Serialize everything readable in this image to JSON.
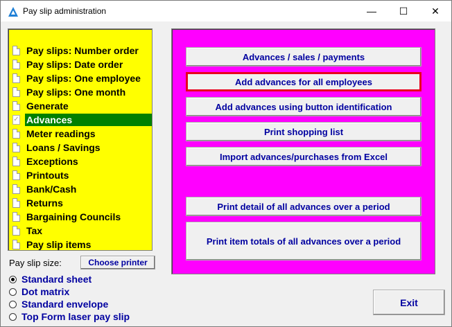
{
  "window": {
    "title": "Pay slip administration",
    "minimize_glyph": "—",
    "maximize_glyph": "☐",
    "close_glyph": "✕"
  },
  "menu": {
    "items": [
      {
        "label": "Pay slips: Number order",
        "icon": "document-icon"
      },
      {
        "label": "Pay slips: Date order",
        "icon": "document-icon"
      },
      {
        "label": "Pay slips: One employee",
        "icon": "document-icon"
      },
      {
        "label": "Pay slips: One month",
        "icon": "document-icon"
      },
      {
        "label": "Generate",
        "icon": "document-icon"
      },
      {
        "label": "Advances",
        "icon": "checked-document-icon",
        "selected": true
      },
      {
        "label": "Meter readings",
        "icon": "document-icon"
      },
      {
        "label": "Loans / Savings",
        "icon": "document-icon"
      },
      {
        "label": "Exceptions",
        "icon": "document-icon"
      },
      {
        "label": "Printouts",
        "icon": "document-icon"
      },
      {
        "label": "Bank/Cash",
        "icon": "document-icon"
      },
      {
        "label": "Returns",
        "icon": "document-icon"
      },
      {
        "label": "Bargaining Councils",
        "icon": "document-icon"
      },
      {
        "label": "Tax",
        "icon": "document-icon"
      },
      {
        "label": "Pay slip items",
        "icon": "document-icon"
      }
    ],
    "check_glyph": "✓"
  },
  "pay_slip_size": {
    "label": "Pay slip size:",
    "choose_printer_label": "Choose printer",
    "options": [
      {
        "label": "Standard sheet",
        "selected": true
      },
      {
        "label": "Dot matrix",
        "selected": false
      },
      {
        "label": "Standard envelope",
        "selected": false
      },
      {
        "label": "Top Form laser pay slip",
        "selected": false
      }
    ]
  },
  "actions": {
    "advances_sales_payments": "Advances / sales / payments",
    "add_advances_all": "Add advances for all employees",
    "add_advances_button_id": "Add advances using button identification",
    "print_shopping_list": "Print shopping list",
    "import_from_excel": "Import advances/purchases from Excel",
    "print_detail_period": "Print detail of all advances over a period",
    "print_item_totals_period": "Print item totals of all advances over a period"
  },
  "exit_label": "Exit",
  "colors": {
    "menu_background": "#ffff00",
    "selected_background": "#008000",
    "action_panel_background": "#ff00ff",
    "button_text": "#0000a0",
    "focus_border": "#e8001c"
  }
}
